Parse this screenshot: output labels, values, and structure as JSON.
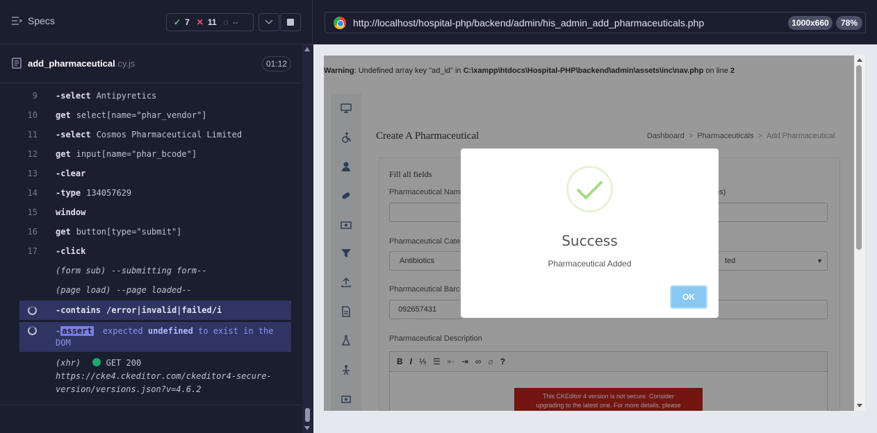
{
  "reporter": {
    "specs_label": "Specs",
    "passed": "7",
    "failed": "11",
    "pending": "--",
    "file_name": "add_pharmaceutical",
    "file_ext": ".cy.js",
    "duration": "01:12"
  },
  "commands": [
    {
      "num": "9",
      "cmd": "-select",
      "arg": "Antipyretics"
    },
    {
      "num": "10",
      "cmd": "get",
      "arg": "select[name=\"phar_vendor\"]"
    },
    {
      "num": "11",
      "cmd": "-select",
      "arg": "Cosmos Pharmaceutical Limited"
    },
    {
      "num": "12",
      "cmd": "get",
      "arg": "input[name=\"phar_bcode\"]"
    },
    {
      "num": "13",
      "cmd": "-clear",
      "arg": ""
    },
    {
      "num": "14",
      "cmd": "-type",
      "arg": "134057629"
    },
    {
      "num": "15",
      "cmd": "window",
      "arg": ""
    },
    {
      "num": "16",
      "cmd": "get",
      "arg": "button[type=\"submit\"]"
    },
    {
      "num": "17",
      "cmd": "-click",
      "arg": ""
    }
  ],
  "events": {
    "form_sub": "(form sub)",
    "form_sub_msg": "--submitting form--",
    "page_load": "(page load)",
    "page_load_msg": "--page loaded--",
    "contains_cmd": "-contains",
    "contains_arg": "/error|invalid|failed/i",
    "assert_dash": "-",
    "assert_tag": "assert",
    "assert_msg_1": "expected",
    "assert_msg_2": "undefined",
    "assert_msg_3": "to exist in the",
    "assert_msg_4": "DOM",
    "xhr": "(xhr)",
    "xhr_status": "GET 200",
    "xhr_url_1": "https://cke4.ckeditor.com/ckeditor4-secure-",
    "xhr_url_2": "version/versions.json?v=4.6.2"
  },
  "browser": {
    "url": "http://localhost/hospital-php/backend/admin/his_admin_add_pharmaceuticals.php",
    "viewport": "1000x660",
    "zoom": "78%"
  },
  "aut": {
    "warning_label": "Warning",
    "warning_text_1": ": Undefined array key \"ad_id\" in ",
    "warning_path": "C:\\xampp\\htdocs\\Hospital-PHP\\backend\\admin\\assets\\inc\\nav.php",
    "warning_text_2": " on line ",
    "warning_line": "2",
    "page_title": "Create A Pharmaceutical",
    "breadcrumb": [
      "Dashboard",
      "Pharmaceuticals",
      "Add Pharmaceutical"
    ],
    "breadcrumb_sep": ">",
    "form_heading": "Fill all fields",
    "label_name": "Pharmaceutical Name",
    "label_qty_tail": "ns)",
    "label_category": "Pharmaceutical Cate",
    "category_value": "Antibiotics",
    "vendor_tail": "ted",
    "label_barcode": "Pharmaceutical Barc",
    "barcode_value": "092657431",
    "label_desc": "Pharmaceutical Description",
    "editor_tools": [
      "B",
      "I",
      "⅓",
      "☰",
      "⇤",
      "⇥",
      "∞",
      "⌀",
      "?"
    ],
    "ck_warning_1": "This CKEditor 4 version is not secure. Consider",
    "ck_warning_2": "upgrading to the latest one. For more details, please"
  },
  "modal": {
    "title": "Success",
    "text": "Pharmaceutical Added",
    "ok_label": "OK"
  },
  "colors": {
    "passed": "#4fd08b",
    "failed": "#f0587d",
    "active_row": "#2f3462",
    "ok_button": "#89c8f0",
    "checkmark": "#a5dc86"
  }
}
